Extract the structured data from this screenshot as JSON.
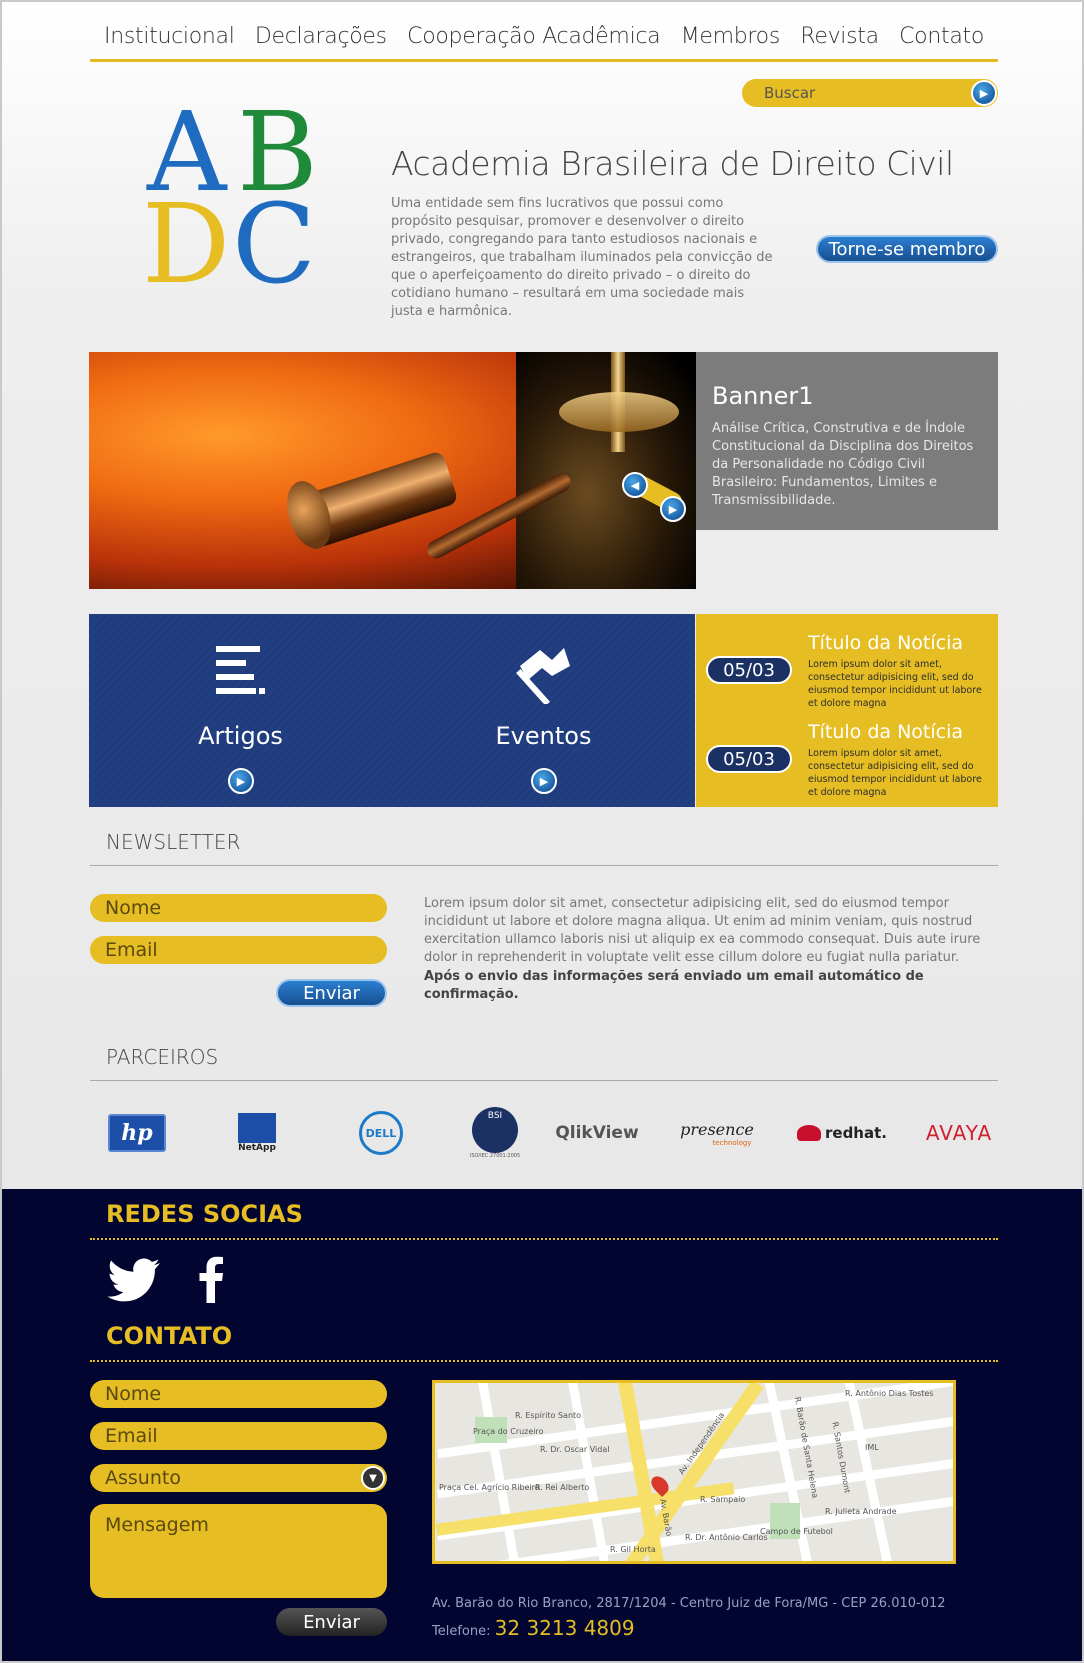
{
  "nav": {
    "items": [
      "Institucional",
      "Declarações",
      "Cooperação Acadêmica",
      "Membros",
      "Revista",
      "Contato"
    ]
  },
  "search": {
    "label": "Buscar"
  },
  "logo": {
    "letters": [
      "A",
      "B",
      "D",
      "C"
    ],
    "colors": [
      "#1e6bbf",
      "#1f8a3a",
      "#e6bd22",
      "#1e6bbf"
    ]
  },
  "hero": {
    "title": "Academia Brasileira de Direito Civil",
    "description": "Uma entidade sem fins lucrativos que possui como propósito pesquisar, promover e desenvolver o direito privado, congregando para tanto estudiosos nacionais e estrangeiros, que trabalham iluminados pela convicção de que o aperfeiçoamento do direito privado – o direito do cotidiano humano – resultará em uma sociedade mais justa e harmônica.",
    "join_label": "Torne-se membro"
  },
  "banner": {
    "title": "Banner1",
    "text": "Análise Crítica, Construtiva e de Índole Constitucional da Disciplina dos Direitos da Personalidade no Código Civil Brasileiro: Fundamentos, Limites e Transmissibilidade."
  },
  "tiles": [
    {
      "label": "Artigos",
      "icon": "list-icon"
    },
    {
      "label": "Eventos",
      "icon": "flag-icon"
    }
  ],
  "news": [
    {
      "date": "05/03",
      "title": "Título da Notícia",
      "text": "Lorem ipsum dolor sit amet, consectetur adipisicing elit, sed do eiusmod tempor incididunt ut labore et dolore magna"
    },
    {
      "date": "05/03",
      "title": "Título da Notícia",
      "text": "Lorem ipsum dolor sit amet, consectetur adipisicing elit, sed do eiusmod tempor incididunt ut labore et dolore magna"
    }
  ],
  "newsletter": {
    "title": "NEWSLETTER",
    "name_placeholder": "Nome",
    "email_placeholder": "Email",
    "send_label": "Enviar",
    "text": "Lorem ipsum dolor sit amet, consectetur adipisicing elit, sed do eiusmod tempor incididunt ut labore et dolore magna aliqua. Ut enim ad minim veniam, quis nostrud exercitation ullamco laboris nisi ut aliquip ex ea commodo consequat. Duis aute irure dolor in reprehenderit in voluptate velit esse cillum dolore eu fugiat nulla pariatur.",
    "bold_text": "Após o envio das informações será enviado um email automático de confirmação."
  },
  "partners": {
    "title": "PARCEIROS",
    "items": [
      "hp",
      "NetApp",
      "DELL",
      "BSI",
      "QlikView",
      "presence",
      "redhat.",
      "AVAYA"
    ],
    "sublabels": {
      "presence": "technology",
      "bsi": "ISO/IEC 27001:2005"
    }
  },
  "footer": {
    "social_title": "REDES SOCIAS",
    "contact_title": "CONTATO",
    "form": {
      "name": "Nome",
      "email": "Email",
      "subject": "Assunto",
      "message": "Mensagem",
      "send": "Enviar"
    },
    "map_labels": [
      "R. Espírito Santo",
      "R. Dr. Oscar Vidal",
      "R. Rei Alberto",
      "R. Sampaio",
      "Av. Independência",
      "R. Barão de Santa Helena",
      "R. Santos Dumont",
      "R. Antônio Dias Tostes",
      "R. Julieta Andrade",
      "R. Dr. Antônio Carlos",
      "R. Gil Horta",
      "Praça do Cruzeiro",
      "Praça Cel. Agrício Ribeiro",
      "Campo de Futebol",
      "IML",
      "Av. Barão"
    ],
    "address": "Av. Barão do Rio Branco, 2817/1204 - Centro Juiz de Fora/MG - CEP 26.010-012",
    "phone_label": "Telefone:",
    "phone": "32 3213 4809"
  },
  "colors": {
    "accent": "#e6bd22",
    "navy": "#1f3d7c",
    "footer": "#020530",
    "button_blue": "#2b7fd1"
  }
}
